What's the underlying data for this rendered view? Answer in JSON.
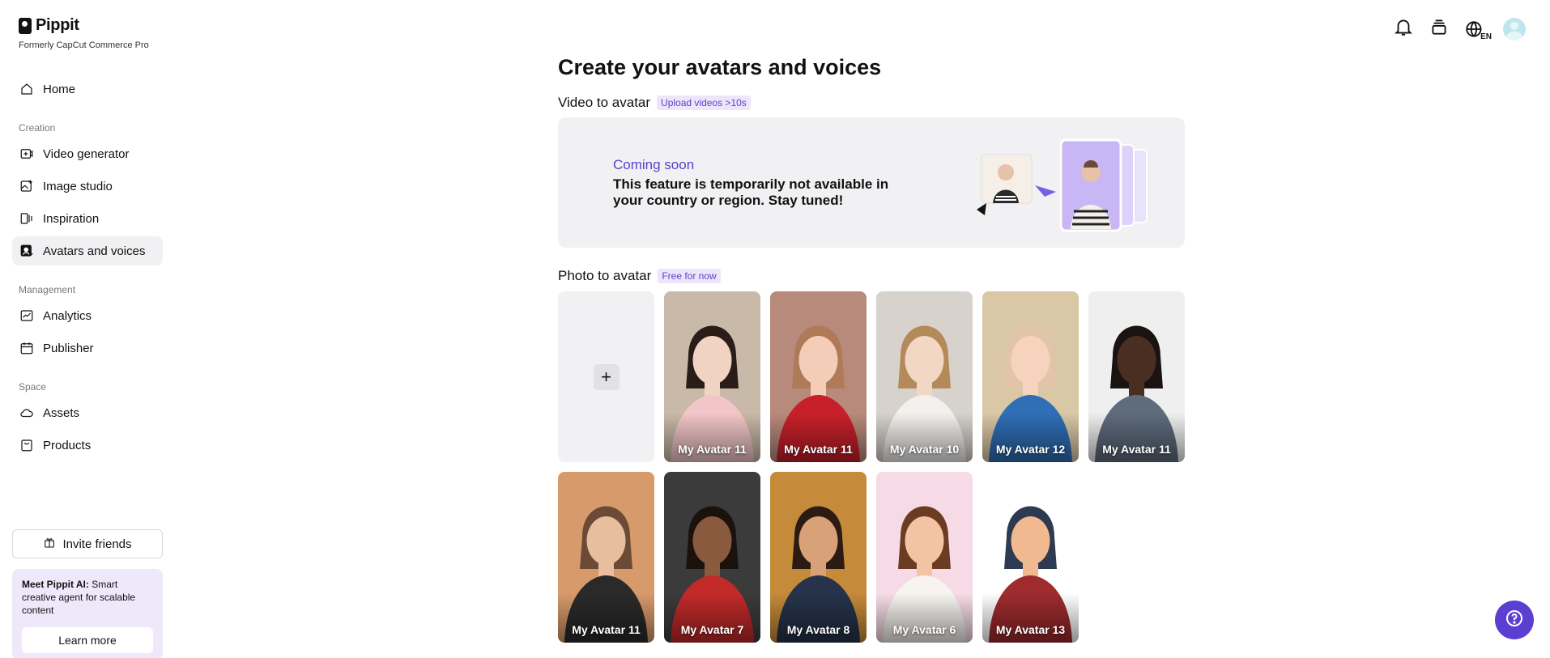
{
  "brand": {
    "name": "Pippit",
    "subtitle": "Formerly CapCut Commerce Pro"
  },
  "sidebar": {
    "home": "Home",
    "sections": {
      "creation": "Creation",
      "management": "Management",
      "space": "Space"
    },
    "items": [
      {
        "label": "Video generator",
        "icon": "video-plus-icon"
      },
      {
        "label": "Image studio",
        "icon": "image-plus-icon"
      },
      {
        "label": "Inspiration",
        "icon": "inspiration-icon"
      },
      {
        "label": "Avatars and voices",
        "icon": "avatar-icon",
        "active": true
      },
      {
        "label": "Analytics",
        "icon": "analytics-icon"
      },
      {
        "label": "Publisher",
        "icon": "calendar-icon"
      },
      {
        "label": "Assets",
        "icon": "cloud-icon"
      },
      {
        "label": "Products",
        "icon": "bag-icon"
      }
    ],
    "invite": "Invite friends",
    "promo": {
      "bold": "Meet Pippit AI:",
      "text": " Smart creative agent for scalable content",
      "button": "Learn more"
    }
  },
  "topbar": {
    "icons": [
      "bell-icon",
      "stack-icon",
      "globe-icon",
      "avatar"
    ],
    "language": "EN"
  },
  "main": {
    "title": "Create your avatars and voices",
    "video_section": {
      "heading": "Video to avatar",
      "pill": "Upload videos >10s",
      "banner_title": "Coming soon",
      "banner_message": "This feature is temporarily not available in your country or region. Stay tuned!"
    },
    "photo_section": {
      "heading": "Photo to avatar",
      "pill": "Free for now",
      "add_label": "+",
      "avatars": [
        {
          "label": "My Avatar 11",
          "bg": "#c9b9a8",
          "skin": "#f1d3c3",
          "hair": "#2a1d18",
          "shirt": "#f2c6c8"
        },
        {
          "label": "My Avatar 11",
          "bg": "#b88a7b",
          "skin": "#f3cdb7",
          "hair": "#b07a58",
          "shirt": "#c8202a"
        },
        {
          "label": "My Avatar 10",
          "bg": "#d7d2cc",
          "skin": "#f1d7c4",
          "hair": "#b48a5a",
          "shirt": "#f3f1ee"
        },
        {
          "label": "My Avatar 12",
          "bg": "#d9c7a6",
          "skin": "#f5d3bd",
          "hair": "#e2c5a8",
          "shirt": "#2f6fb6"
        },
        {
          "label": "My Avatar 11",
          "bg": "#efefef",
          "skin": "#4a2e22",
          "hair": "#1a1311",
          "shirt": "#5e6c7c"
        },
        {
          "label": "My Avatar 11",
          "bg": "#d69a6b",
          "skin": "#e8bf9e",
          "hair": "#6b4b36",
          "shirt": "#2a2a2a"
        },
        {
          "label": "My Avatar 7",
          "bg": "#3b3b3b",
          "skin": "#8a5a3e",
          "hair": "#1b120d",
          "shirt": "#c22a2a"
        },
        {
          "label": "My Avatar 8",
          "bg": "#c58a3a",
          "skin": "#d9a178",
          "hair": "#2b1b12",
          "shirt": "#26334a"
        },
        {
          "label": "My Avatar 6",
          "bg": "#f6dbe6",
          "skin": "#f3c4a3",
          "hair": "#6b3c22",
          "shirt": "#f7f4ef"
        },
        {
          "label": "My Avatar 13",
          "bg": "#ffffff",
          "skin": "#f1b98f",
          "hair": "#2d3a4f",
          "shirt": "#9e2b2e"
        }
      ]
    }
  }
}
